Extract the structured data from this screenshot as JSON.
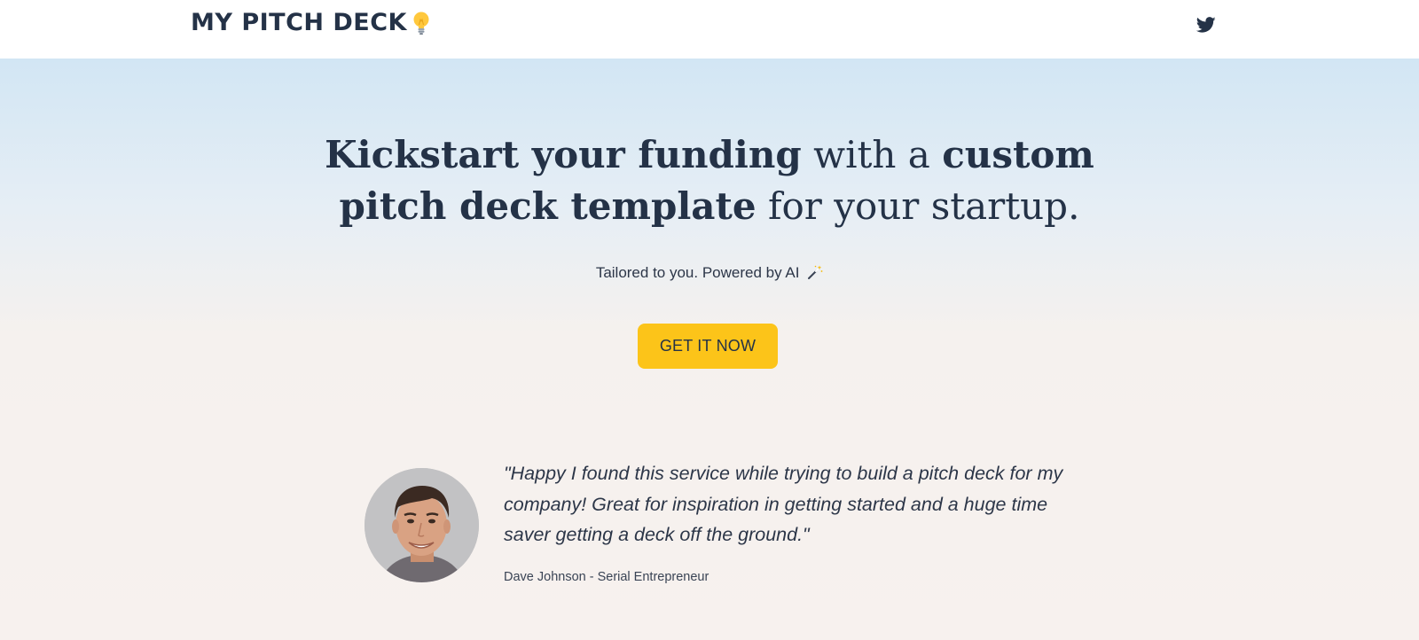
{
  "header": {
    "brand": "MY PITCH DECK",
    "brand_icon": "lightbulb-icon",
    "social_icon": "twitter-icon"
  },
  "hero": {
    "headline": {
      "part1_bold": "Kickstart your funding",
      "part2": " with a ",
      "part3_bold": "custom pitch deck template",
      "part4": " for your startup."
    },
    "tagline": "Tailored to you. Powered by AI",
    "tagline_icon": "magic-wand-icon",
    "cta_label": "GET IT NOW"
  },
  "testimonial": {
    "quote": "\"Happy I found this service while trying to build a pitch deck for my company! Great for inspiration in getting started and a huge time saver getting a deck off the ground.\"",
    "author": "Dave Johnson - Serial Entrepreneur",
    "avatar_icon": "avatar"
  },
  "colors": {
    "text": "#243247",
    "cta": "#fcc419",
    "hero_top": "#d2e6f4",
    "hero_bottom": "#f7f1ee",
    "header_bg": "#ffffff"
  }
}
